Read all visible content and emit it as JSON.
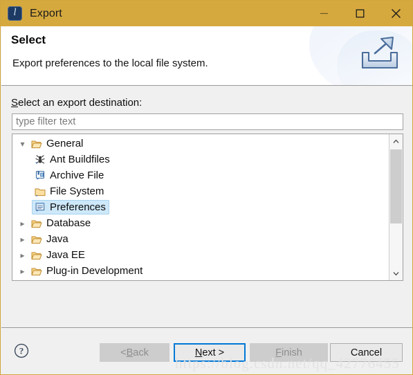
{
  "window": {
    "title": "Export",
    "app_icon": "eclipse-logo-icon",
    "titlebar_color": "#d6a93e",
    "border_color": "#d0a63c",
    "controls": {
      "minimize": "minimize-icon",
      "maximize": "maximize-icon",
      "close": "close-icon"
    }
  },
  "banner": {
    "title": "Select",
    "description": "Export preferences to the local file system.",
    "icon": "export-tray-arrow-icon"
  },
  "main": {
    "destination_label_prefix": "S",
    "destination_label_rest": "elect an export destination:",
    "filter": {
      "value": "",
      "placeholder": "type filter text"
    },
    "tree": [
      {
        "label": "General",
        "icon": "folder-open-icon",
        "twisty": "expanded",
        "indent": 0,
        "selected": false
      },
      {
        "label": "Ant Buildfiles",
        "icon": "ant-icon",
        "twisty": "none",
        "indent": 1,
        "selected": false
      },
      {
        "label": "Archive File",
        "icon": "archive-file-icon",
        "twisty": "none",
        "indent": 1,
        "selected": false
      },
      {
        "label": "File System",
        "icon": "folder-icon",
        "twisty": "none",
        "indent": 1,
        "selected": false
      },
      {
        "label": "Preferences",
        "icon": "preferences-icon",
        "twisty": "none",
        "indent": 1,
        "selected": true
      },
      {
        "label": "Database",
        "icon": "folder-open-icon",
        "twisty": "collapsed",
        "indent": 0,
        "selected": false
      },
      {
        "label": "Java",
        "icon": "folder-open-icon",
        "twisty": "collapsed",
        "indent": 0,
        "selected": false
      },
      {
        "label": "Java EE",
        "icon": "folder-open-icon",
        "twisty": "collapsed",
        "indent": 0,
        "selected": false
      },
      {
        "label": "Plug-in Development",
        "icon": "folder-open-icon",
        "twisty": "collapsed",
        "indent": 0,
        "selected": false
      }
    ],
    "selection_color": "#cde8f9",
    "scrollbar": {
      "up_arrow": "chevron-up-icon",
      "down_arrow": "chevron-down-icon"
    }
  },
  "footer": {
    "help": "?",
    "buttons": {
      "back": {
        "prefix": "< ",
        "mnemonic": "B",
        "rest": "ack",
        "state": "disabled"
      },
      "next": {
        "prefix": "",
        "mnemonic": "N",
        "rest": "ext >",
        "state": "default"
      },
      "finish": {
        "prefix": "",
        "mnemonic": "F",
        "rest": "inish",
        "state": "disabled"
      },
      "cancel": {
        "prefix": "",
        "mnemonic": "",
        "rest": "Cancel",
        "state": "normal"
      }
    },
    "accent_color": "#0078d7"
  },
  "watermark": "https://blog.csdn.net/qq_42776455"
}
